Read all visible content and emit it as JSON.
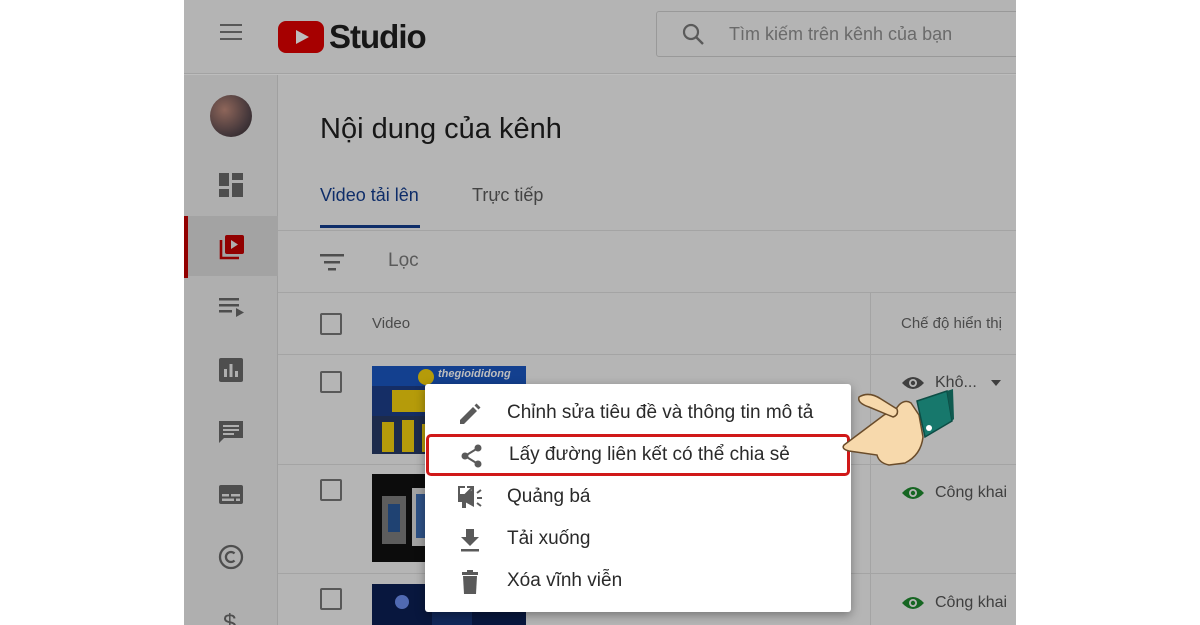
{
  "app": {
    "logo_text": "Studio"
  },
  "search": {
    "placeholder": "Tìm kiếm trên kênh của bạn"
  },
  "sidebar": {
    "items": [
      "dashboard-icon",
      "content-icon",
      "playlists-icon",
      "analytics-icon",
      "comments-icon",
      "subtitles-icon",
      "copyright-icon",
      "monetization-icon"
    ],
    "active_index": 1
  },
  "page": {
    "title": "Nội dung của kênh"
  },
  "tabs": [
    {
      "label": "Video tải lên"
    },
    {
      "label": "Trực tiếp"
    }
  ],
  "filter": {
    "label": "Lọc"
  },
  "table": {
    "headers": {
      "video": "Video",
      "visibility": "Chế độ hiển thị"
    },
    "rows": [
      {
        "thumbnail_text": "thegioididong",
        "visibility": "Khô..."
      },
      {
        "visibility": "Công khai"
      },
      {
        "visibility": "Công khai"
      }
    ]
  },
  "context_menu": {
    "items": [
      {
        "label": "Chỉnh sửa tiêu đề và thông tin mô tả",
        "icon": "pencil-icon"
      },
      {
        "label": "Lấy đường liên kết có thể chia sẻ",
        "icon": "share-icon",
        "highlighted": true
      },
      {
        "label": "Quảng bá",
        "icon": "megaphone-icon"
      },
      {
        "label": "Tải xuống",
        "icon": "download-icon"
      },
      {
        "label": "Xóa vĩnh viễn",
        "icon": "trash-icon"
      }
    ]
  },
  "colors": {
    "accent_blue": "#143d8e",
    "youtube_red": "#e00000",
    "highlight_red": "#d01818",
    "visibility_green": "#1e8a2e"
  }
}
